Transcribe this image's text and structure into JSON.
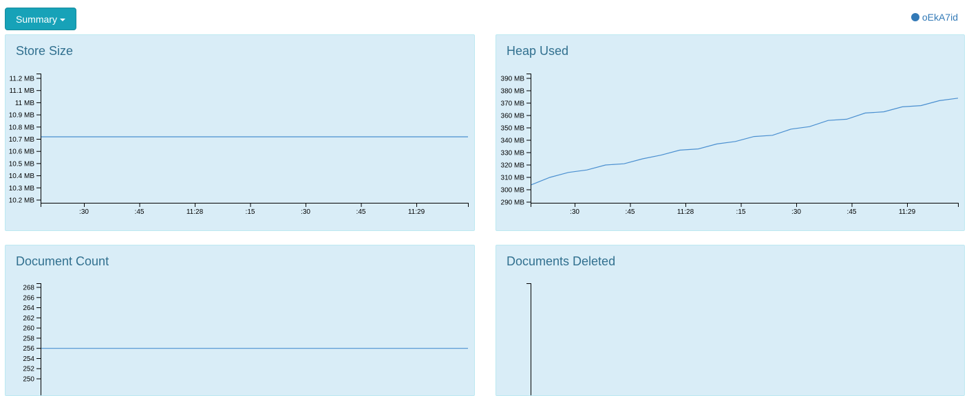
{
  "toolbar": {
    "summary_label": "Summary",
    "caret_icon": "caret-down-icon"
  },
  "node": {
    "id_label": "oEkA7id",
    "dot_color": "#337ab7"
  },
  "x_ticks": [
    ":30",
    ":45",
    "11:28",
    ":15",
    ":30",
    ":45",
    "11:29"
  ],
  "panels": [
    {
      "title": "Store Size",
      "y_ticks": [
        "11.2 MB",
        "11.1 MB",
        "11 MB",
        "10.9 MB",
        "10.8 MB",
        "10.7 MB",
        "10.6 MB",
        "10.5 MB",
        "10.4 MB",
        "10.3 MB",
        "10.2 MB"
      ]
    },
    {
      "title": "Heap Used",
      "y_ticks": [
        "390 MB",
        "380 MB",
        "370 MB",
        "360 MB",
        "350 MB",
        "340 MB",
        "330 MB",
        "320 MB",
        "310 MB",
        "300 MB",
        "290 MB"
      ]
    },
    {
      "title": "Document Count",
      "y_ticks": [
        "268",
        "266",
        "264",
        "262",
        "260",
        "258",
        "256",
        "254",
        "252",
        "250"
      ]
    },
    {
      "title": "Documents Deleted",
      "y_ticks": []
    }
  ],
  "chart_data": [
    {
      "type": "line",
      "title": "Store Size",
      "x": [
        ":30",
        ":45",
        "11:28",
        ":15",
        ":30",
        ":45",
        "11:29"
      ],
      "series": [
        {
          "values": [
            10.72,
            10.72,
            10.72,
            10.72,
            10.72,
            10.72,
            10.72,
            10.72
          ]
        }
      ],
      "ylim": [
        10.2,
        11.2
      ]
    },
    {
      "type": "line",
      "title": "Heap Used",
      "x": [
        ":30",
        ":45",
        "11:28",
        ":15",
        ":30",
        ":45",
        "11:29"
      ],
      "series": [
        {
          "values": [
            304,
            310,
            314,
            316,
            320,
            321,
            325,
            328,
            332,
            333,
            337,
            339,
            343,
            344,
            349,
            351,
            356,
            357,
            362,
            363,
            367,
            368,
            372,
            374
          ]
        }
      ],
      "ylim": [
        290,
        390
      ]
    },
    {
      "type": "line",
      "title": "Document Count",
      "x": [],
      "series": [
        {
          "values": [
            256,
            256,
            256,
            256,
            256,
            256,
            256,
            256
          ]
        }
      ],
      "ylim": [
        250,
        268
      ]
    },
    {
      "type": "line",
      "title": "Documents Deleted",
      "x": [],
      "series": []
    }
  ]
}
